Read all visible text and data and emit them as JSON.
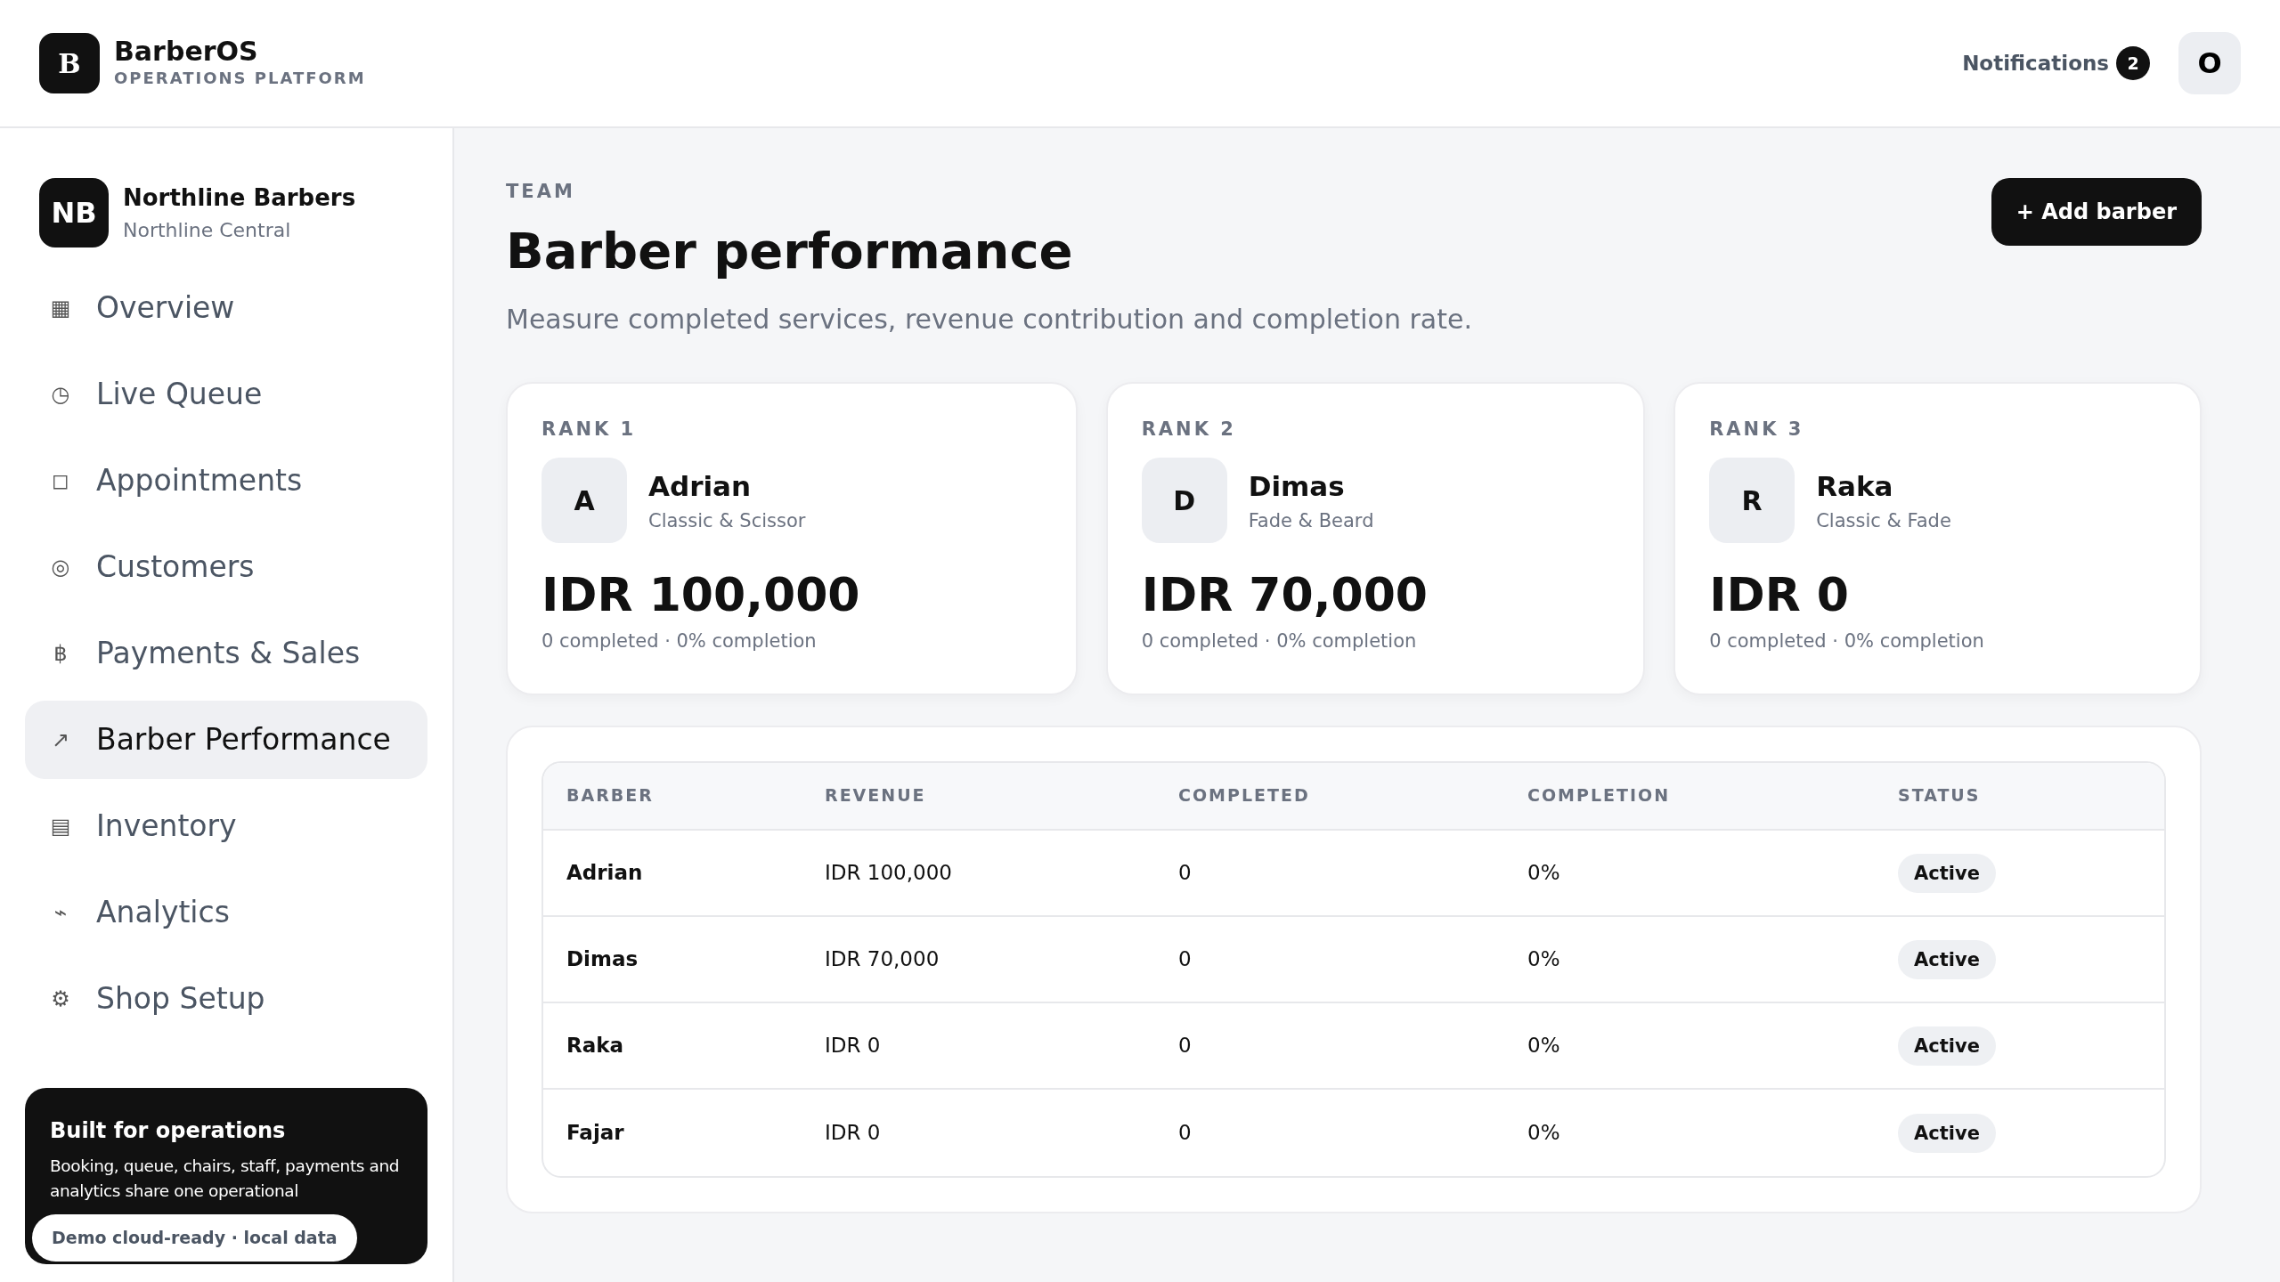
{
  "brand": {
    "logo": "B",
    "name": "BarberOS",
    "tagline": "OPERATIONS PLATFORM"
  },
  "header": {
    "notifications_label": "Notifications",
    "notifications_count": "2",
    "avatar": "O"
  },
  "shop": {
    "initials": "NB",
    "name": "Northline Barbers",
    "location": "Northline Central"
  },
  "nav": [
    {
      "icon": "▦",
      "label": "Overview",
      "selected": false
    },
    {
      "icon": "◷",
      "label": "Live Queue",
      "selected": false
    },
    {
      "icon": "◻",
      "label": "Appointments",
      "selected": false
    },
    {
      "icon": "◎",
      "label": "Customers",
      "selected": false
    },
    {
      "icon": "฿",
      "label": "Payments & Sales",
      "selected": false
    },
    {
      "icon": "↗",
      "label": "Barber Performance",
      "selected": true
    },
    {
      "icon": "▤",
      "label": "Inventory",
      "selected": false
    },
    {
      "icon": "⌁",
      "label": "Analytics",
      "selected": false
    },
    {
      "icon": "⚙",
      "label": "Shop Setup",
      "selected": false
    }
  ],
  "promo": {
    "title": "Built for operations",
    "text": "Booking, queue, chairs, staff, payments and analytics share one operational",
    "pill": "Demo cloud-ready · local data"
  },
  "page": {
    "eyebrow": "TEAM",
    "title": "Barber performance",
    "subtitle": "Measure completed services, revenue contribution and completion rate.",
    "action": "+ Add barber"
  },
  "ranks": [
    {
      "rank": "RANK 1",
      "initial": "A",
      "name": "Adrian",
      "specialty": "Classic & Scissor",
      "revenue": "IDR 100,000",
      "summary": "0 completed · 0% completion"
    },
    {
      "rank": "RANK 2",
      "initial": "D",
      "name": "Dimas",
      "specialty": "Fade & Beard",
      "revenue": "IDR 70,000",
      "summary": "0 completed · 0% completion"
    },
    {
      "rank": "RANK 3",
      "initial": "R",
      "name": "Raka",
      "specialty": "Classic & Fade",
      "revenue": "IDR 0",
      "summary": "0 completed · 0% completion"
    }
  ],
  "table": {
    "columns": [
      "BARBER",
      "REVENUE",
      "COMPLETED",
      "COMPLETION",
      "STATUS"
    ],
    "rows": [
      [
        "Adrian",
        "IDR 100,000",
        "0",
        "0%",
        "Active"
      ],
      [
        "Dimas",
        "IDR 70,000",
        "0",
        "0%",
        "Active"
      ],
      [
        "Raka",
        "IDR 0",
        "0",
        "0%",
        "Active"
      ],
      [
        "Fajar",
        "IDR 0",
        "0",
        "0%",
        "Active"
      ]
    ]
  }
}
